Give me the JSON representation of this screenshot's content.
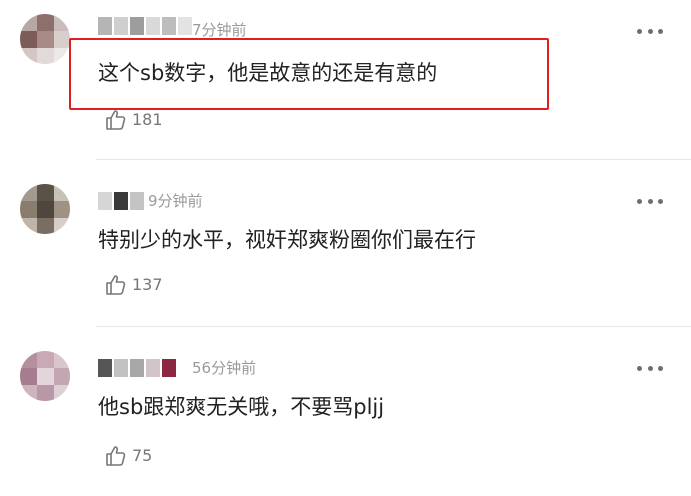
{
  "comments": [
    {
      "time": "7分钟前",
      "text": "这个sb数字，他是故意的还是有意的",
      "likes": "181",
      "highlighted": true
    },
    {
      "time": "9分钟前",
      "text": "特别少的水平，视奸郑爽粉圈你们最在行",
      "likes": "137",
      "highlighted": false
    },
    {
      "time": "56分钟前",
      "text": "他sb跟郑爽无关哦，不要骂pljj",
      "likes": "75",
      "highlighted": false
    }
  ],
  "icons": {
    "more": "more-dots-icon",
    "like": "thumbs-up-icon"
  },
  "colors": {
    "highlight_border": "#e02020",
    "meta_text": "#9a9a9a",
    "body_text": "#222222"
  }
}
